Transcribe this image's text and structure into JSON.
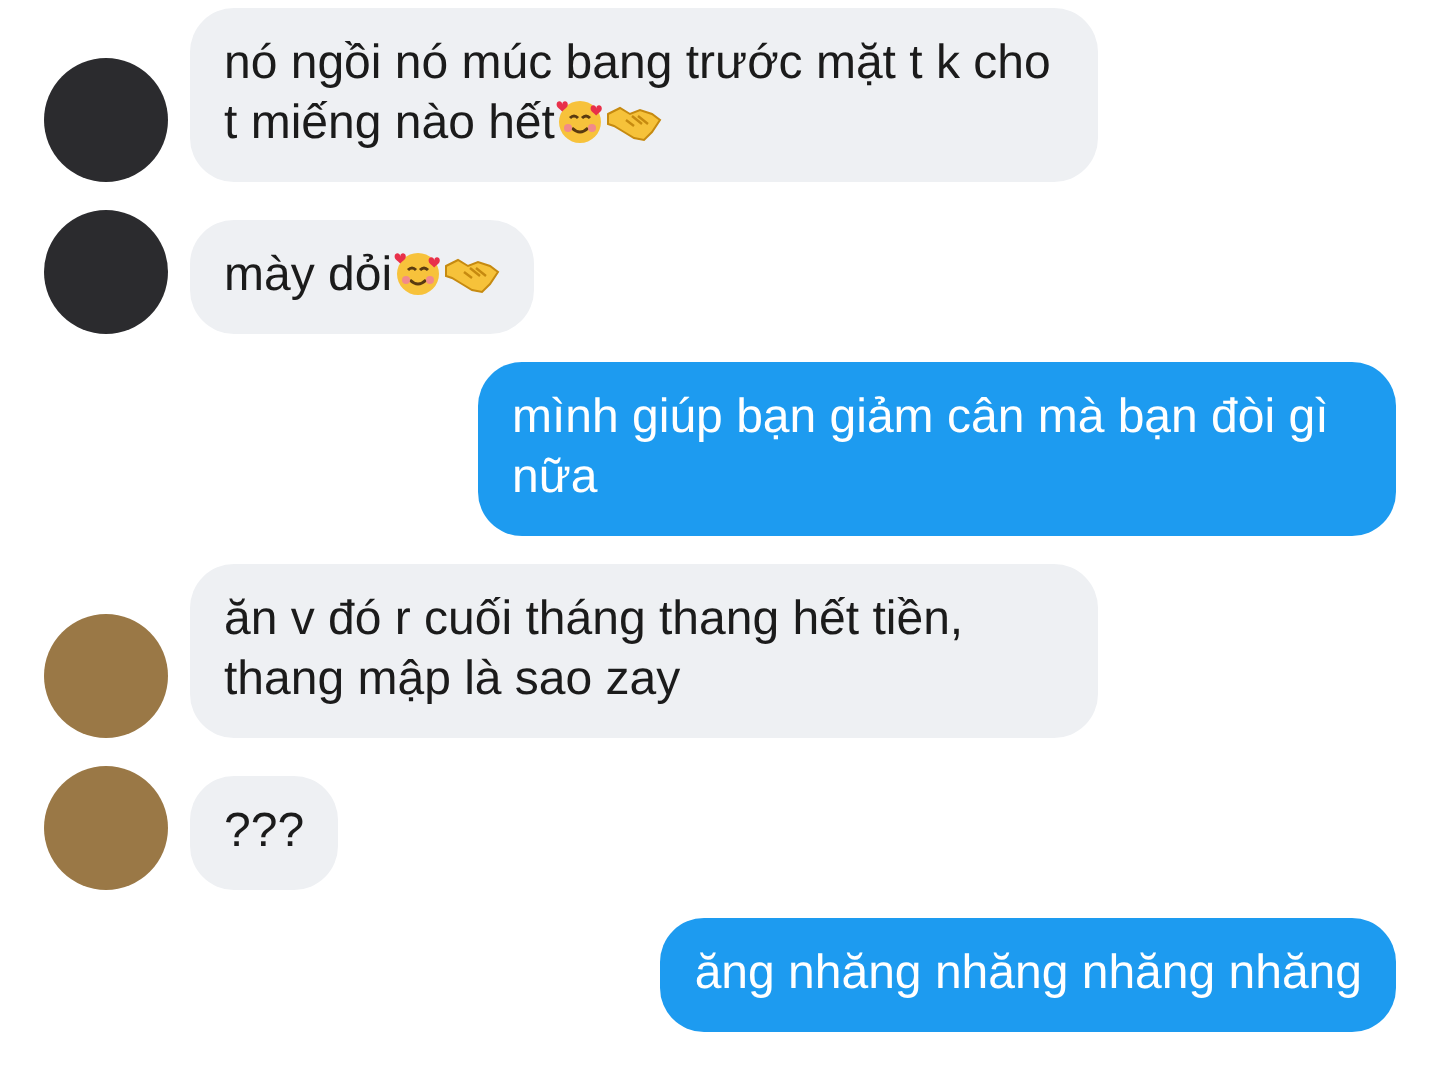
{
  "messages": [
    {
      "kind": "incoming",
      "avatar": {
        "color": "#2b2b2e"
      },
      "text": "nó ngồi nó múc bang trước mặt t k cho t miếng nào hết",
      "emojis": [
        {
          "kind": "hearts"
        },
        {
          "kind": "handshake"
        }
      ]
    },
    {
      "kind": "incoming",
      "avatar": {
        "color": "#2b2b2e"
      },
      "text": "mày dỏi",
      "emojis": [
        {
          "kind": "hearts"
        },
        {
          "kind": "handshake"
        }
      ]
    },
    {
      "kind": "outgoing",
      "text": "mình giúp bạn giảm cân mà bạn đòi gì nữa"
    },
    {
      "kind": "incoming",
      "avatar": {
        "color": "#9a7846"
      },
      "text": "ăn v đó r cuối tháng thang hết tiền, thang mập là sao zay"
    },
    {
      "kind": "incoming",
      "avatar": {
        "color": "#9a7846"
      },
      "text": "???"
    },
    {
      "kind": "outgoing",
      "text": "ăng nhăng nhăng nhăng nhăng"
    }
  ]
}
